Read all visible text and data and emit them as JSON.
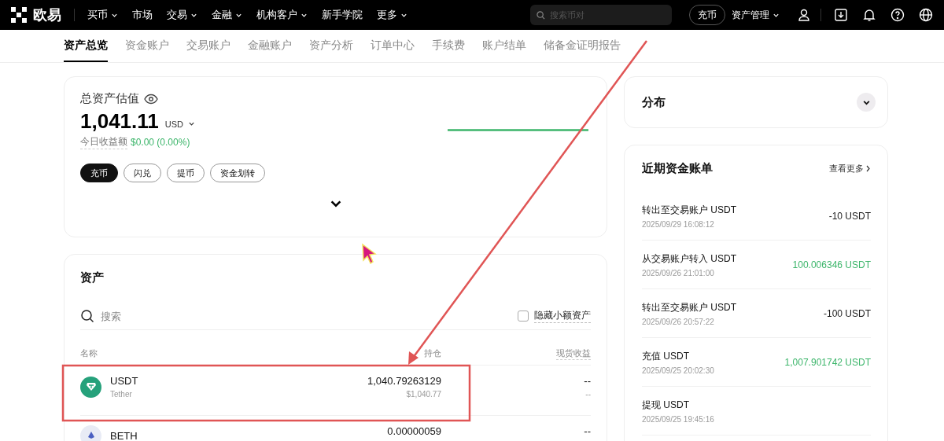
{
  "topbar": {
    "logo": "欧易",
    "nav": [
      {
        "label": "买币",
        "dropdown": true
      },
      {
        "label": "市场",
        "dropdown": false
      },
      {
        "label": "交易",
        "dropdown": true
      },
      {
        "label": "金融",
        "dropdown": true
      },
      {
        "label": "机构客户",
        "dropdown": true
      },
      {
        "label": "新手学院",
        "dropdown": false
      },
      {
        "label": "更多",
        "dropdown": true
      }
    ],
    "search": {
      "placeholder": "搜索币对"
    },
    "deposit_button": "充币",
    "asset_menu": "资产管理"
  },
  "tabs": [
    {
      "label": "资产总览",
      "selected": true
    },
    {
      "label": "资金账户",
      "selected": false
    },
    {
      "label": "交易账户",
      "selected": false
    },
    {
      "label": "金融账户",
      "selected": false
    },
    {
      "label": "资产分析",
      "selected": false
    },
    {
      "label": "订单中心",
      "selected": false
    },
    {
      "label": "手续费",
      "selected": false
    },
    {
      "label": "账户结单",
      "selected": false
    },
    {
      "label": "储备金证明报告",
      "selected": false
    }
  ],
  "overview": {
    "title": "总资产估值",
    "total": "1,041.11",
    "currency": "USD",
    "pnl_label": "今日收益额",
    "pnl_value": "$0.00 (0.00%)",
    "actions": [
      {
        "label": "充币",
        "primary": true
      },
      {
        "label": "闪兑",
        "primary": false
      },
      {
        "label": "提币",
        "primary": false
      },
      {
        "label": "资金划转",
        "primary": false
      }
    ]
  },
  "assets": {
    "title": "资产",
    "search": {
      "placeholder": "搜索"
    },
    "hide_small": {
      "label": "隐藏小额资产",
      "checked": false
    },
    "columns": [
      "名称",
      "持仓",
      "现货收益"
    ],
    "rows": [
      {
        "symbol": "USDT",
        "name": "Tether",
        "holding": "1,040.79263129",
        "value": "$1,040.77",
        "pnl": "--",
        "pnl_sub": "--"
      },
      {
        "symbol": "BETH",
        "holding": "0.00000059",
        "pnl": "--"
      }
    ]
  },
  "distribution": {
    "title": "分布"
  },
  "bills": {
    "title": "近期资金账单",
    "more": "查看更多",
    "items": [
      {
        "title": "转出至交易账户 USDT",
        "time": "2025/09/29 16:08:12",
        "amount": "-10 USDT",
        "color": "#1a1a1a"
      },
      {
        "title": "从交易账户转入 USDT",
        "time": "2025/09/26 21:01:00",
        "amount": "100.006346 USDT",
        "color": "#3cb56a"
      },
      {
        "title": "转出至交易账户 USDT",
        "time": "2025/09/26 20:57:22",
        "amount": "-100 USDT",
        "color": "#1a1a1a"
      },
      {
        "title": "充值 USDT",
        "time": "2025/09/25 20:02:30",
        "amount": "1,007.901742 USDT",
        "color": "#3cb56a"
      },
      {
        "title": "提现 USDT",
        "time": "2025/09/25 19:45:16"
      }
    ]
  }
}
